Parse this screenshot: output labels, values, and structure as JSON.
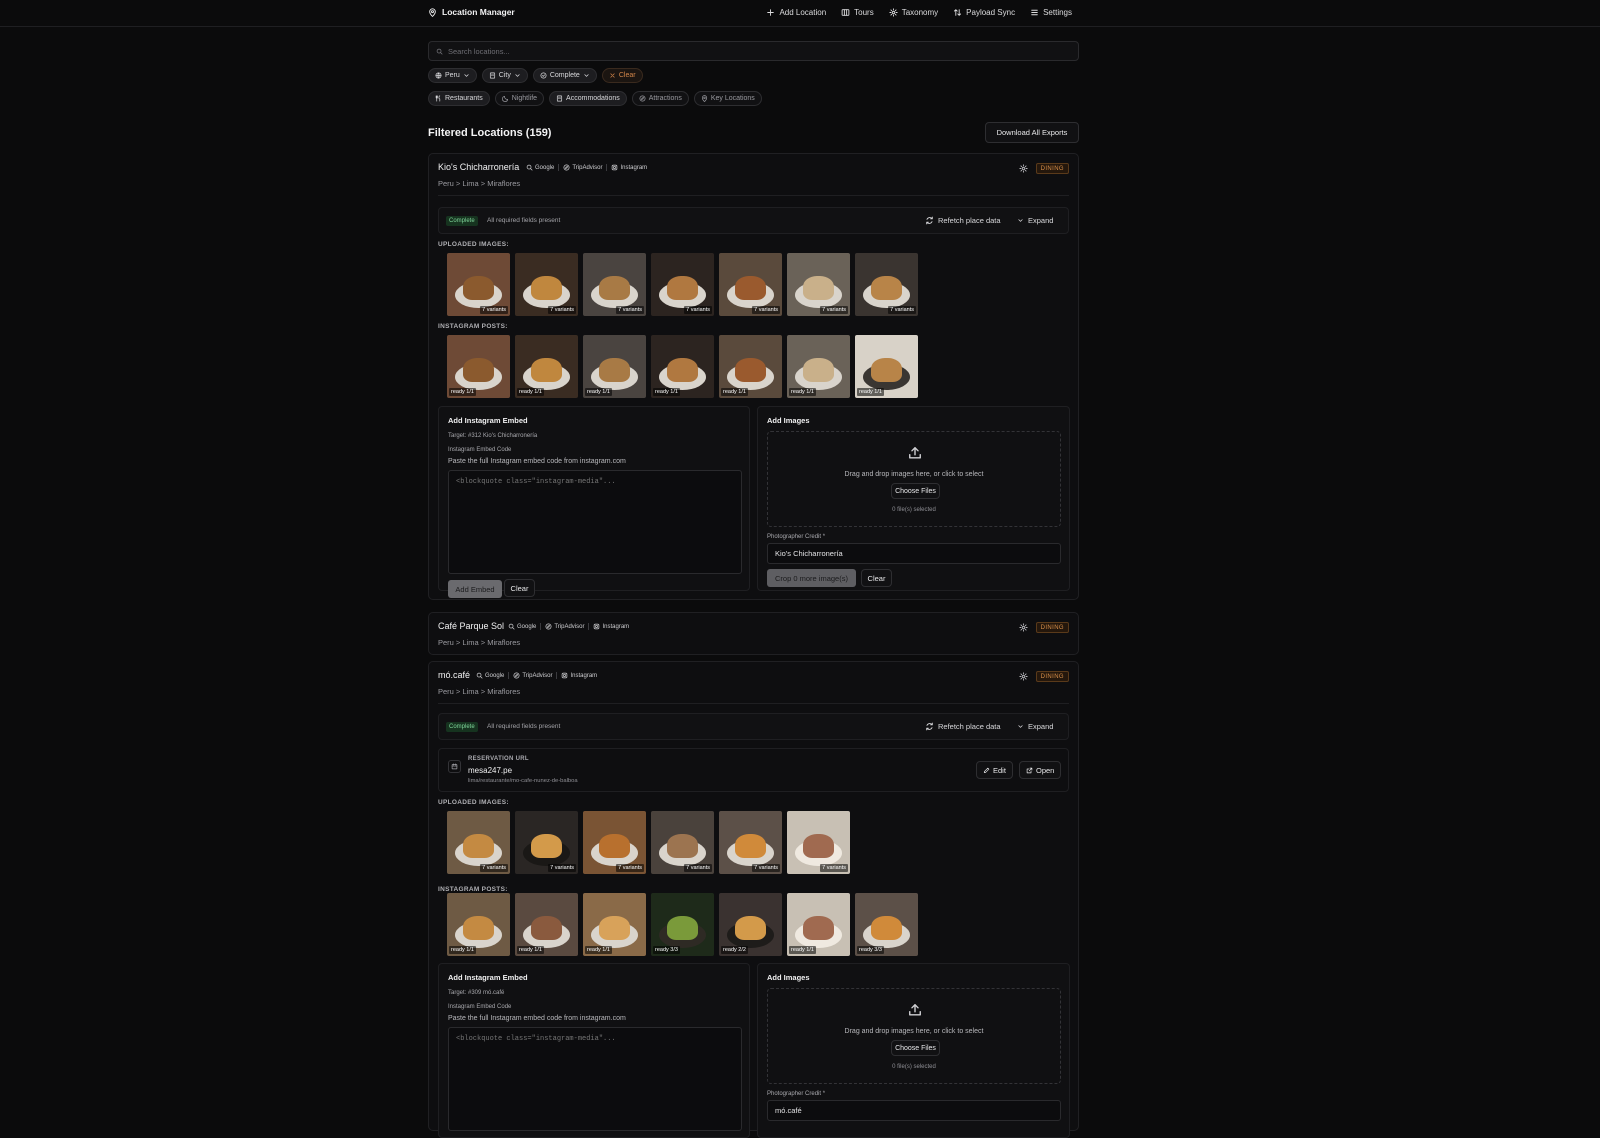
{
  "app": {
    "title": "Location Manager"
  },
  "nav": [
    {
      "label": "Add Location",
      "icon": "plus-icon"
    },
    {
      "label": "Tours",
      "icon": "map-icon"
    },
    {
      "label": "Taxonomy",
      "icon": "gear-icon"
    },
    {
      "label": "Payload Sync",
      "icon": "sync-icon"
    },
    {
      "label": "Settings",
      "icon": "list-icon"
    }
  ],
  "search": {
    "placeholder": "Search locations..."
  },
  "filters": [
    {
      "label": "Peru",
      "icon": "globe-icon"
    },
    {
      "label": "City",
      "icon": "building-icon"
    },
    {
      "label": "Complete",
      "icon": "check-circle-icon"
    },
    {
      "label": "Clear",
      "icon": "x-icon"
    }
  ],
  "categories": [
    {
      "label": "Restaurants",
      "icon": "utensils-icon"
    },
    {
      "label": "Nightlife",
      "icon": "moon-icon"
    },
    {
      "label": "Accommodations",
      "icon": "building-icon"
    },
    {
      "label": "Attractions",
      "icon": "compass-icon"
    },
    {
      "label": "Key Locations",
      "icon": "pin-icon"
    }
  ],
  "list": {
    "heading": "Filtered Locations (159)",
    "download_label": "Download All Exports"
  },
  "common": {
    "link_google": "Google",
    "link_tripadvisor": "TripAdvisor",
    "link_instagram": "Instagram",
    "badge": "DINING",
    "complete": "Complete",
    "complete_text": "All required fields present",
    "refetch": "Refetch place data",
    "expand": "Expand",
    "uploaded": "UPLOADED IMAGES:",
    "instagram_posts": "INSTAGRAM POSTS:",
    "embed_title": "Add Instagram Embed",
    "embed_code_label": "Instagram Embed Code",
    "embed_help": "Paste the full Instagram embed code from instagram.com",
    "embed_placeholder": "<blockquote class=\"instagram-media\"...",
    "add_embed": "Add Embed",
    "clear": "Clear",
    "add_images": "Add Images",
    "drop_text": "Drag and drop images here, or click to select",
    "choose_files": "Choose Files",
    "files_selected": "0 file(s) selected",
    "credit_label": "Photographer Credit *",
    "crop": "Crop 0 more image(s)",
    "reservation_label": "RESERVATION URL",
    "edit": "Edit",
    "open": "Open"
  },
  "locations": [
    {
      "name": "Kio's Chicharronería",
      "breadcrumb": "Peru > Lima > Miraflores",
      "uploaded": [
        "7 variants",
        "7 variants",
        "7 variants",
        "7 variants",
        "7 variants",
        "7 variants",
        "7 variants"
      ],
      "posts": [
        "ready 1/1",
        "ready 1/1",
        "ready 1/1",
        "ready 1/1",
        "ready 1/1",
        "ready 1/1",
        "ready 1/1"
      ],
      "target": "Target: #312 Kio's Chicharronería",
      "credit": "Kio's Chicharronería"
    },
    {
      "name": "Café Parque Sol",
      "breadcrumb": "Peru > Lima > Miraflores"
    },
    {
      "name": "mó.café",
      "breadcrumb": "Peru > Lima > Miraflores",
      "reservation_host": "mesa247.pe",
      "reservation_path": "lima/restaurante/mo-cafe-nunez-de-balboa",
      "uploaded": [
        "7 variants",
        "7 variants",
        "7 variants",
        "7 variants",
        "7 variants",
        "7 variants"
      ],
      "posts": [
        "ready 1/1",
        "ready 1/1",
        "ready 1/1",
        "ready 3/3",
        "ready 2/2",
        "ready 1/1",
        "ready 3/3"
      ],
      "target": "Target: #309 mó.café",
      "credit": "mó.café"
    }
  ]
}
